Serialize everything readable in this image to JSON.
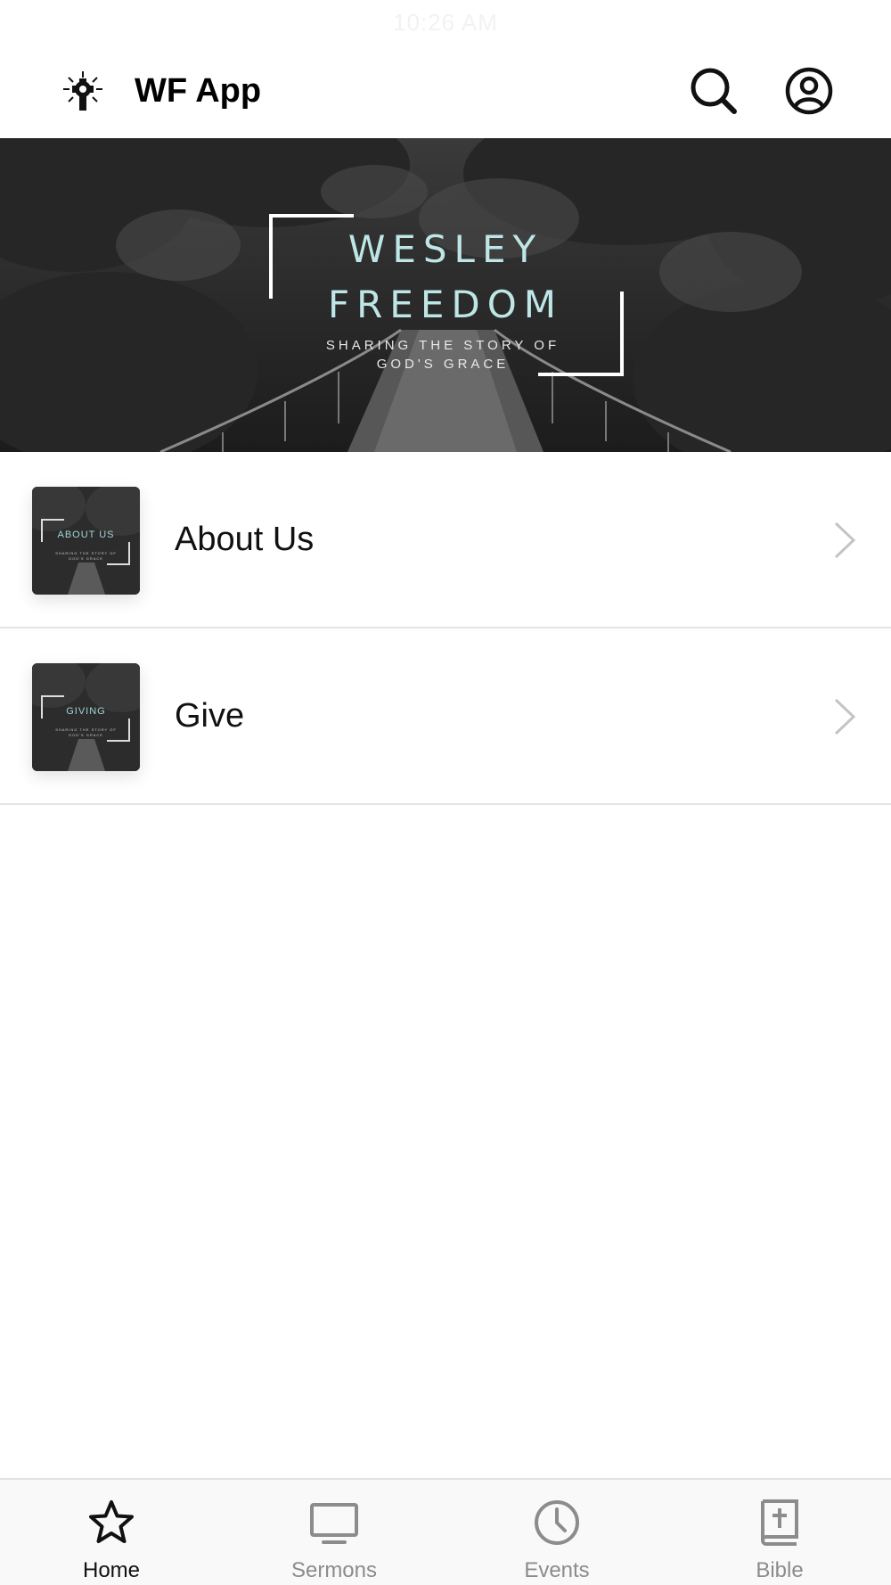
{
  "status_bar": {
    "time": "10:26 AM"
  },
  "header": {
    "title": "WF App",
    "logo_icon": "celtic-cross-logo-icon",
    "search_icon": "search-icon",
    "account_icon": "user-account-icon"
  },
  "hero": {
    "line1": "WESLEY",
    "line2": "FREEDOM",
    "tagline": "SHARING THE STORY OF GOD'S GRACE",
    "accent_color": "#bfe6e6"
  },
  "list": {
    "items": [
      {
        "title": "About Us",
        "thumb_label": "ABOUT US",
        "thumb_sub": "SHARING THE STORY OF GOD'S GRACE"
      },
      {
        "title": "Give",
        "thumb_label": "GIVING",
        "thumb_sub": "SHARING THE STORY OF GOD'S GRACE"
      }
    ]
  },
  "tabs": [
    {
      "label": "Home",
      "icon": "star-icon",
      "active": true
    },
    {
      "label": "Sermons",
      "icon": "monitor-icon",
      "active": false
    },
    {
      "label": "Events",
      "icon": "clock-icon",
      "active": false
    },
    {
      "label": "Bible",
      "icon": "bible-icon",
      "active": false
    }
  ],
  "colors": {
    "active_tab": "#111111",
    "inactive_tab": "#8c8c8c",
    "divider": "#e4e4e4"
  }
}
